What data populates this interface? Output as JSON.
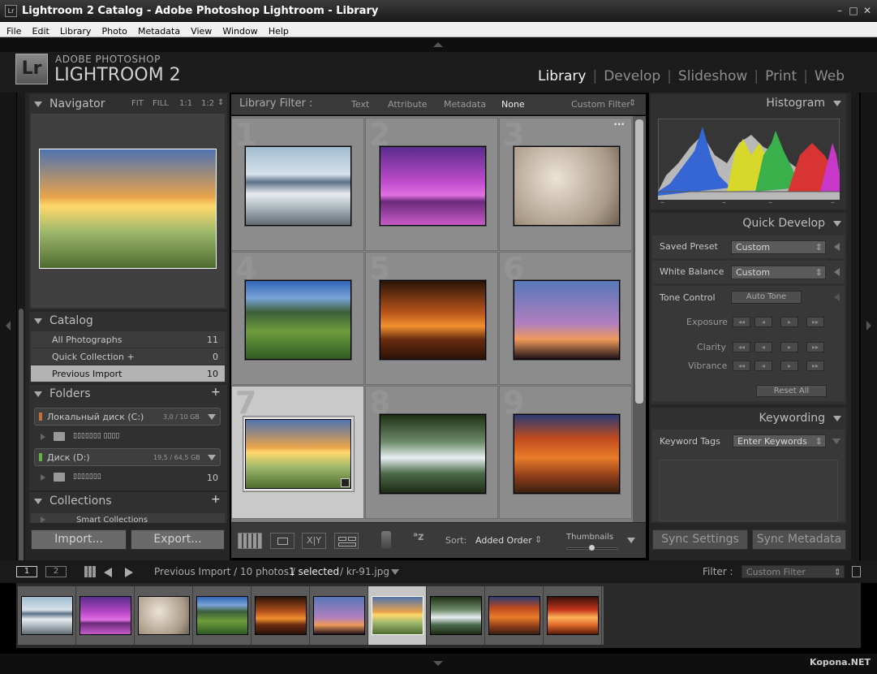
{
  "window": {
    "title": "Lightroom 2 Catalog - Adobe Photoshop Lightroom - Library",
    "app_icon": "Lr"
  },
  "menu": [
    "File",
    "Edit",
    "Library",
    "Photo",
    "Metadata",
    "View",
    "Window",
    "Help"
  ],
  "identity": {
    "logo": "Lr",
    "brand_top": "ADOBE PHOTOSHOP",
    "brand_bottom": "LIGHTROOM 2"
  },
  "modules": {
    "library": "Library",
    "develop": "Develop",
    "slideshow": "Slideshow",
    "print": "Print",
    "web": "Web",
    "active": "Library"
  },
  "navigator": {
    "title": "Navigator",
    "zoom": [
      "FIT",
      "FILL",
      "1:1",
      "1:2"
    ]
  },
  "catalog": {
    "title": "Catalog",
    "items": [
      {
        "label": "All Photographs",
        "count": "11"
      },
      {
        "label": "Quick Collection +",
        "count": "0"
      },
      {
        "label": "Previous Import",
        "count": "10"
      }
    ],
    "selected": "Previous Import"
  },
  "folders": {
    "title": "Folders",
    "add": "+",
    "volumes": [
      {
        "name": "Локальный диск (C:)",
        "size": "3,0 / 10 GB",
        "sub": "▯▯▯▯▯▯▯ ▯▯▯▯",
        "subcount": ""
      },
      {
        "name": "Диск (D:)",
        "size": "19,5 / 64,5 GB",
        "sub": "▯▯▯▯▯▯▯",
        "subcount": "10"
      }
    ]
  },
  "collections": {
    "title": "Collections",
    "add": "+",
    "items": [
      "Smart Collections"
    ]
  },
  "left_buttons": {
    "import": "Import...",
    "export": "Export..."
  },
  "filter_bar": {
    "label": "Library Filter :",
    "options": [
      "Text",
      "Attribute",
      "Metadata",
      "None"
    ],
    "active": "None",
    "preset": "Custom Filter"
  },
  "grid": {
    "cells": [
      {
        "num": "1",
        "image": "misty-mountain-lake"
      },
      {
        "num": "2",
        "image": "purple-palm-sunset"
      },
      {
        "num": "3",
        "image": "smooth-rocks"
      },
      {
        "num": "4",
        "image": "green-mountain-valley"
      },
      {
        "num": "5",
        "image": "orange-beach-palm"
      },
      {
        "num": "6",
        "image": "palm-silhouettes"
      },
      {
        "num": "7",
        "image": "cliff-sunset",
        "selected": true
      },
      {
        "num": "8",
        "image": "waterfall-forest"
      },
      {
        "num": "9",
        "image": "autumn-trees"
      }
    ],
    "menu_dots": "···"
  },
  "toolbar": {
    "sort_label": "Sort:",
    "sort_value": "Added Order",
    "thumbnails_label": "Thumbnails",
    "xy": "X|Y"
  },
  "histogram": {
    "title": "Histogram",
    "ticks": [
      "–",
      "–",
      "–",
      "–"
    ]
  },
  "quick_develop": {
    "title": "Quick Develop",
    "saved_preset": {
      "label": "Saved Preset",
      "value": "Custom"
    },
    "white_balance": {
      "label": "White Balance",
      "value": "Custom"
    },
    "tone_control": {
      "label": "Tone Control",
      "button": "Auto Tone"
    },
    "sliders": [
      "Exposure",
      "Clarity",
      "Vibrance"
    ],
    "step_glyphs": [
      "◂◂",
      "◂",
      "▸",
      "▸▸"
    ],
    "reset": "Reset All"
  },
  "keywording": {
    "title": "Keywording",
    "tags_label": "Keyword Tags",
    "tags_value": "Enter Keywords"
  },
  "right_buttons": {
    "sync_settings": "Sync Settings",
    "sync_metadata": "Sync Metadata"
  },
  "filmstrip_bar": {
    "page1": "1",
    "page2": "2",
    "path_prefix": "Previous Import / 10 photos /",
    "selected": "1 selected",
    "path_suffix": "/ kr-91.jpg",
    "filter_label": "Filter :",
    "filter_value": "Custom Filter"
  },
  "filmstrip": {
    "selected_index": 6,
    "count": 10
  },
  "watermark": "Kopona.NET"
}
